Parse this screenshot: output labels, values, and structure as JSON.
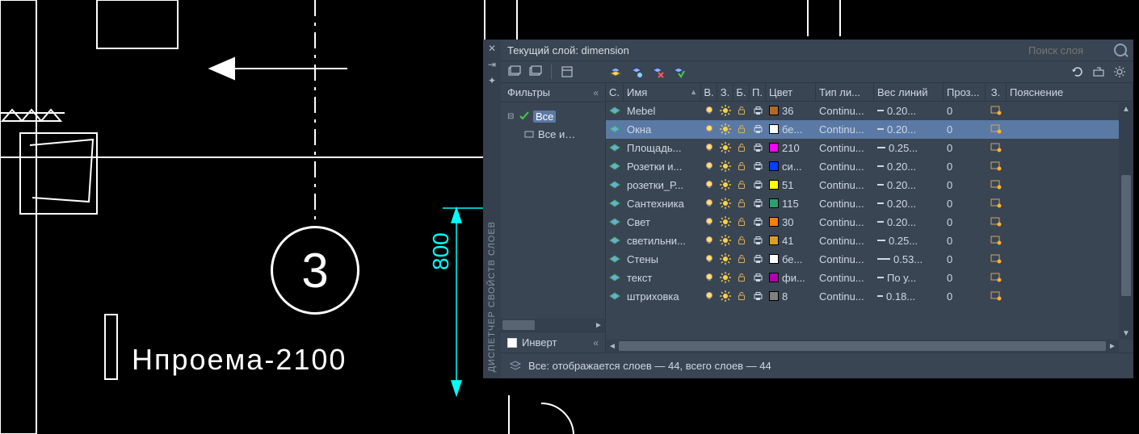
{
  "cad": {
    "axis_bubble": "3",
    "hproema": "Нпроема-2100",
    "dim800": "800"
  },
  "panel": {
    "side_label": "ДИСПЕТЧЕР СВОЙСТВ СЛОЕВ",
    "title": "Текущий слой: dimension",
    "search_placeholder": "Поиск слоя",
    "filters_label": "Фильтры",
    "collapse_glyph": "«",
    "tree_collapse_glyph": "⊟",
    "tree_root": "Все",
    "tree_child": "Все и…",
    "invert_label": "Инверт",
    "status": "Все: отображается слоев — 44, всего слоев — 44",
    "columns": {
      "s": "С.",
      "name": "Имя",
      "on": "В.",
      "freeze": "З.",
      "lock": "Б.",
      "plot": "П.",
      "color": "Цвет",
      "ltype": "Тип ли...",
      "lweight": "Вес линий",
      "trans": "Проз...",
      "z": "З.",
      "desc": "Пояснение"
    },
    "layers": [
      {
        "name": "Mebel",
        "color_name": "36",
        "swatch": "#b26a2a",
        "ltype": "Continu...",
        "lw": "0.20...",
        "lwpx": 8,
        "tr": "0"
      },
      {
        "name": "Окна",
        "color_name": "бе...",
        "swatch": "#ffffff",
        "ltype": "Continu...",
        "lw": "0.20...",
        "lwpx": 8,
        "tr": "0",
        "selected": true
      },
      {
        "name": "Площадь...",
        "color_name": "210",
        "swatch": "#ff00ff",
        "ltype": "Continu...",
        "lw": "0.25...",
        "lwpx": 10,
        "tr": "0"
      },
      {
        "name": "Розетки и...",
        "color_name": "си...",
        "swatch": "#0040ff",
        "ltype": "Continu...",
        "lw": "0.20...",
        "lwpx": 8,
        "tr": "0"
      },
      {
        "name": "розетки_Р...",
        "color_name": "51",
        "swatch": "#ffff00",
        "ltype": "Continu...",
        "lw": "0.20...",
        "lwpx": 8,
        "tr": "0"
      },
      {
        "name": "Сантехника",
        "color_name": "115",
        "swatch": "#2aa06a",
        "ltype": "Continu...",
        "lw": "0.20...",
        "lwpx": 8,
        "tr": "0"
      },
      {
        "name": "Свет",
        "color_name": "30",
        "swatch": "#ff7f00",
        "ltype": "Continu...",
        "lw": "0.20...",
        "lwpx": 8,
        "tr": "0"
      },
      {
        "name": "светильни...",
        "color_name": "41",
        "swatch": "#d8a020",
        "ltype": "Continu...",
        "lw": "0.25...",
        "lwpx": 10,
        "tr": "0"
      },
      {
        "name": "Стены",
        "color_name": "бе...",
        "swatch": "#ffffff",
        "ltype": "Continu...",
        "lw": "0.53...",
        "lwpx": 16,
        "tr": "0"
      },
      {
        "name": "текст",
        "color_name": "фи...",
        "swatch": "#b000b0",
        "ltype": "Continu...",
        "lw": "По у...",
        "lwpx": 8,
        "tr": "0"
      },
      {
        "name": "штриховка",
        "color_name": "8",
        "swatch": "#808080",
        "ltype": "Continu...",
        "lw": "0.18...",
        "lwpx": 7,
        "tr": "0"
      }
    ]
  }
}
